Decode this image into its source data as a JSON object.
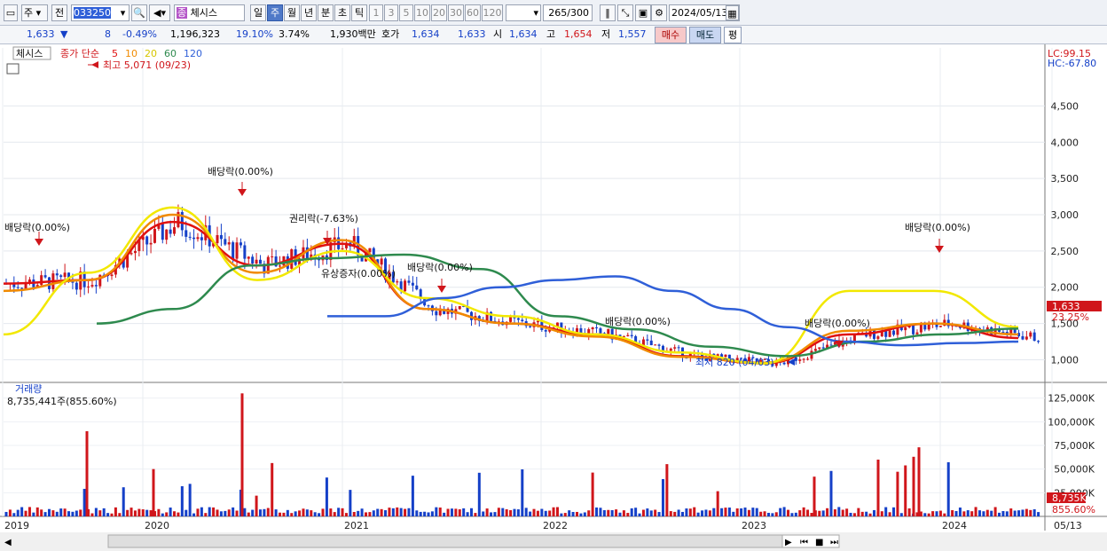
{
  "toolbar": {
    "type_label": "주",
    "jeon_label": "전",
    "code_value": "033250",
    "name_value": "체시스",
    "name_badge": "종",
    "periods": [
      "일",
      "주",
      "월",
      "년",
      "분",
      "초",
      "틱"
    ],
    "active_period": "주",
    "intervals": [
      "1",
      "3",
      "5",
      "10",
      "20",
      "30",
      "60",
      "120"
    ],
    "count_value": "265",
    "count_total": "/300",
    "date_value": "2024/05/13"
  },
  "quote": {
    "price": "1,633",
    "change_arrow": "▼",
    "change": "8",
    "change_pct": "-0.49%",
    "volume": "1,196,323",
    "vol_ratio": "19.10%",
    "turnover": "3.74%",
    "amount": "1,930백만",
    "hoga_label": "호가",
    "ask": "1,634",
    "bid": "1,633",
    "open_label": "시",
    "open": "1,634",
    "high_label": "고",
    "high": "1,654",
    "low_label": "저",
    "low": "1,557",
    "buy_label": "매수",
    "sell_label": "매도",
    "pyeong_label": "평"
  },
  "price_panel": {
    "stock_label": "체시스",
    "ma_title": "종가 단순",
    "ma_periods": [
      "5",
      "10",
      "20",
      "60",
      "120"
    ],
    "lc": "LC:99.15",
    "hc": "HC:-67.80",
    "current_price_tag": "1,633",
    "current_pct_tag": "23.25%",
    "y_ticks": [
      "4,500",
      "4,000",
      "3,500",
      "3,000",
      "2,500",
      "2,000",
      "1,500",
      "1,000"
    ],
    "annotations": {
      "high": "최고 5,071 (09/23)",
      "low": "최저 820 (04/03)",
      "div1": "배당락(0.00%)",
      "div2": "배당락(0.00%)",
      "rights": "권리락(-7.63%)",
      "bonus": "유상증자(0.00%)",
      "div3": "배당락(0.00%)",
      "div4": "배당락(0.00%)",
      "div5": "배당락(0.00%)",
      "div6": "배당락(0.00%)"
    }
  },
  "volume_panel": {
    "title": "거래량",
    "value": "8,735,441주(855.60%)",
    "y_ticks": [
      "125,000K",
      "100,000K",
      "75,000K",
      "50,000K",
      "25,000K"
    ],
    "current_tag": "8,735K",
    "current_pct_tag": "855.60%"
  },
  "x_axis": {
    "labels": [
      "2019",
      "2020",
      "2021",
      "2022",
      "2023",
      "2024",
      "05/13"
    ]
  },
  "colors": {
    "ma5": "#e01010",
    "ma10": "#f08a00",
    "ma20": "#f2e800",
    "ma60": "#2e8a4e",
    "ma120": "#2f5fd8",
    "up": "#d0161b",
    "down": "#1540c8"
  },
  "chart_data": {
    "type": "line",
    "title": "",
    "xlabel": "",
    "ylabel": "",
    "ylim": [
      700,
      5300
    ],
    "volume_ylim": [
      0,
      135000
    ],
    "x": [
      "2019",
      "2019.5",
      "2020",
      "2020.5",
      "2021",
      "2021.5",
      "2022",
      "2022.5",
      "2023",
      "2023.5",
      "2024",
      "2024.4"
    ],
    "series": [
      {
        "name": "5",
        "values": [
          2050,
          2100,
          2900,
          2300,
          2600,
          1700,
          1500,
          1350,
          1050,
          950,
          1350,
          1500,
          1300
        ]
      },
      {
        "name": "10",
        "values": [
          1950,
          2100,
          3000,
          2200,
          2650,
          1700,
          1500,
          1320,
          1040,
          960,
          1400,
          1500,
          1350
        ]
      },
      {
        "name": "20",
        "values": [
          1350,
          2200,
          3100,
          2100,
          2500,
          1850,
          1600,
          1350,
          1100,
          950,
          1950,
          1950,
          1450
        ]
      },
      {
        "name": "60",
        "values": [
          1500,
          1700,
          2300,
          2400,
          2450,
          2250,
          1600,
          1420,
          1180,
          1050,
          1250,
          1350,
          1430
        ]
      },
      {
        "name": "120",
        "values": [
          1600,
          1600,
          1850,
          2000,
          2100,
          2150,
          1950,
          1700,
          1450,
          1250,
          1200,
          1230,
          1250
        ]
      }
    ]
  }
}
